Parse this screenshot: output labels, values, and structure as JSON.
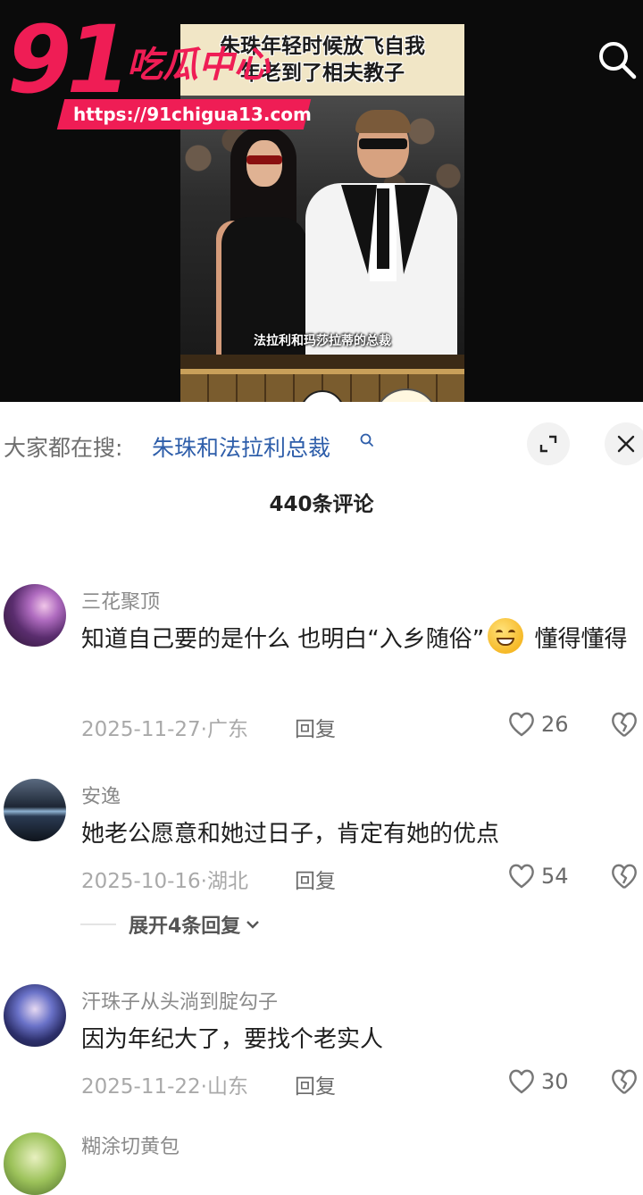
{
  "video": {
    "caption_line1": "朱珠年轻时候放飞自我",
    "caption_line2": "年老到了相夫教子",
    "photo_caption": "法拉利和玛莎拉蒂的总裁"
  },
  "watermark": {
    "number": "91",
    "name": "吃瓜中心",
    "url": "https://91chigua13.com"
  },
  "search_suggestion": {
    "prefix": "大家都在搜:",
    "query": "朱珠和法拉利总裁"
  },
  "comment_count": "440条评论",
  "comments": [
    {
      "user": "三花聚顶",
      "text_part1": "知道自己要的是什么 也明白“入乡随俗”",
      "text_part2": " 懂得懂得",
      "date_location": "2025-11-27·广东",
      "reply": "回复",
      "likes": "26"
    },
    {
      "user": "安逸",
      "text": "她老公愿意和她过日子，肯定有她的优点",
      "date_location": "2025-10-16·湖北",
      "reply": "回复",
      "likes": "54",
      "expand_replies": "展开4条回复"
    },
    {
      "user": "汗珠子从头淌到腚勾子",
      "text": "因为年纪大了，要找个老实人",
      "date_location": "2025-11-22·山东",
      "reply": "回复",
      "likes": "30"
    },
    {
      "user": "糊涂切黄包"
    }
  ],
  "colors": {
    "brand": "#ef1d55",
    "link": "#2e5eaa"
  },
  "icons": [
    "search-icon",
    "expand-icon",
    "close-icon",
    "heart-icon",
    "broken-heart-icon",
    "chevron-down-icon",
    "search-small-icon"
  ]
}
